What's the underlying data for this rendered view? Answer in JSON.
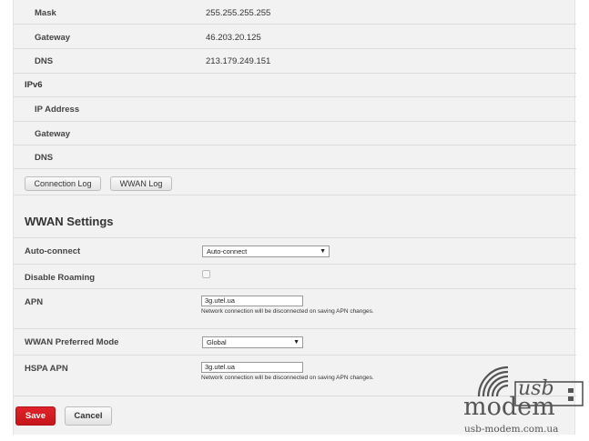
{
  "ipv4": {
    "mask": {
      "label": "Mask",
      "value": "255.255.255.255"
    },
    "gateway": {
      "label": "Gateway",
      "value": "46.203.20.125"
    },
    "dns": {
      "label": "DNS",
      "value": "213.179.249.151"
    }
  },
  "ipv6": {
    "section_label": "IPv6",
    "ip_address": {
      "label": "IP Address",
      "value": ""
    },
    "gateway": {
      "label": "Gateway",
      "value": ""
    },
    "dns": {
      "label": "DNS",
      "value": ""
    }
  },
  "logs": {
    "connection_log_label": "Connection Log",
    "wwan_log_label": "WWAN Log"
  },
  "wwan_settings": {
    "heading": "WWAN Settings",
    "auto_connect": {
      "label": "Auto-connect",
      "selected": "Auto-connect"
    },
    "disable_roaming": {
      "label": "Disable Roaming",
      "checked": false
    },
    "apn": {
      "label": "APN",
      "value": "3g.utel.ua",
      "hint": "Network connection will be disconnected on saving APN changes."
    },
    "preferred_mode": {
      "label": "WWAN Preferred Mode",
      "selected": "Global"
    },
    "hspa_apn": {
      "label": "HSPA APN",
      "value": "3g.utel.ua",
      "hint": "Network connection will be disconnected on saving APN changes."
    }
  },
  "actions": {
    "save_label": "Save",
    "cancel_label": "Cancel"
  },
  "watermark": {
    "usb": "usb",
    "modem": "modem",
    "url": "usb-modem.com.ua"
  },
  "colors": {
    "save_button": "#d41c22",
    "panel_background": "#f2f2f2"
  }
}
